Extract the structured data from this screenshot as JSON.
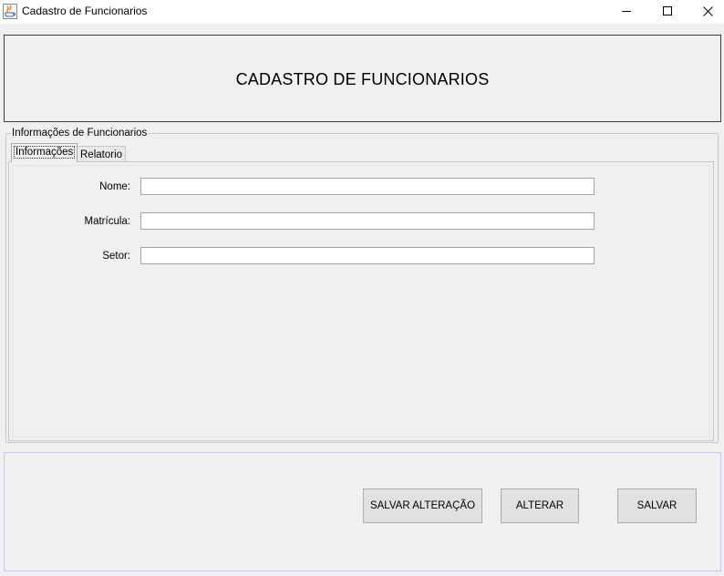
{
  "window": {
    "title": "Cadastro de Funcionarios",
    "controls": [
      "minimize-icon",
      "maximize-icon",
      "close-icon"
    ]
  },
  "header": {
    "title": "CADASTRO DE FUNCIONARIOS"
  },
  "group": {
    "legend": "Informações de Funcionarios",
    "tabs": [
      {
        "label": "Informações",
        "selected": true
      },
      {
        "label": "Relatorio",
        "selected": false
      }
    ]
  },
  "form": {
    "fields": [
      {
        "label": "Nome:",
        "value": ""
      },
      {
        "label": "Matrícula:",
        "value": ""
      },
      {
        "label": "Setor:",
        "value": ""
      }
    ]
  },
  "buttons": {
    "save_changes": "SALVAR ALTERAÇÃO",
    "edit": "ALTERAR",
    "save": "SALVAR"
  }
}
